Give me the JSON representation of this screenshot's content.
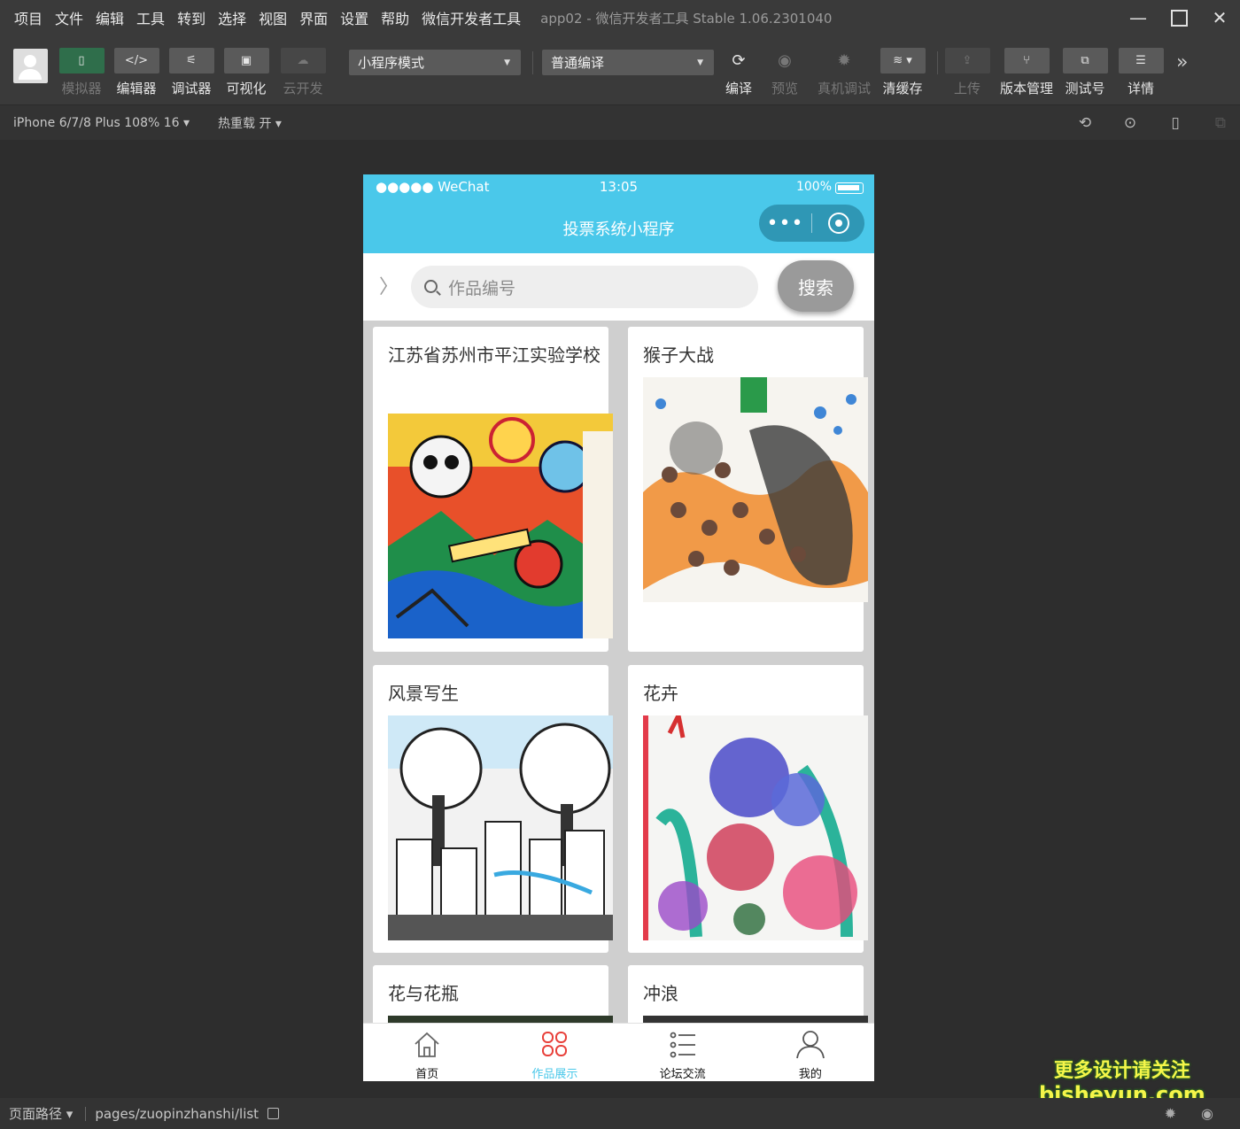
{
  "menubar": {
    "items": [
      "项目",
      "文件",
      "编辑",
      "工具",
      "转到",
      "选择",
      "视图",
      "界面",
      "设置",
      "帮助",
      "微信开发者工具"
    ],
    "title": "app02 - 微信开发者工具 Stable 1.06.2301040"
  },
  "toolbar": {
    "simulator": "模拟器",
    "editor": "编辑器",
    "debugger": "调试器",
    "visual": "可视化",
    "cloud": "云开发",
    "mode_select": "小程序模式",
    "compile_select": "普通编译",
    "compile": "编译",
    "preview": "预览",
    "remote_debug": "真机调试",
    "clear_cache": "清缓存",
    "upload": "上传",
    "version": "版本管理",
    "test_account": "测试号",
    "details": "详情"
  },
  "subbar": {
    "device": "iPhone 6/7/8 Plus 108% 16 ▾",
    "hot_reload": "热重载 开 ▾"
  },
  "phone": {
    "status": {
      "carrier": "●●●●● WeChat",
      "time": "13:05",
      "battery": "100%"
    },
    "nav_title": "投票系统小程序",
    "capsule_dots": "•••",
    "search_placeholder": "作品编号",
    "search_button": "搜索",
    "cards": [
      {
        "title": "江苏省苏州市平江实验学校"
      },
      {
        "title": "猴子大战"
      },
      {
        "title": "风景写生"
      },
      {
        "title": "花卉"
      },
      {
        "title": "花与花瓶"
      },
      {
        "title": "冲浪"
      }
    ],
    "tabs": [
      {
        "label": "首页",
        "icon": "home-icon"
      },
      {
        "label": "作品展示",
        "icon": "works-icon"
      },
      {
        "label": "论坛交流",
        "icon": "list-icon"
      },
      {
        "label": "我的",
        "icon": "user-icon"
      }
    ]
  },
  "bottombar": {
    "label": "页面路径 ▾",
    "path": "pages/zuopinzhanshi/list"
  },
  "watermark": {
    "line1": "更多设计请关注",
    "line2": "bisheyun.com"
  },
  "colors": {
    "accent": "#4ac8ea",
    "toolbar_bg": "#3a3a3a",
    "green_button": "#2f6e4b"
  }
}
